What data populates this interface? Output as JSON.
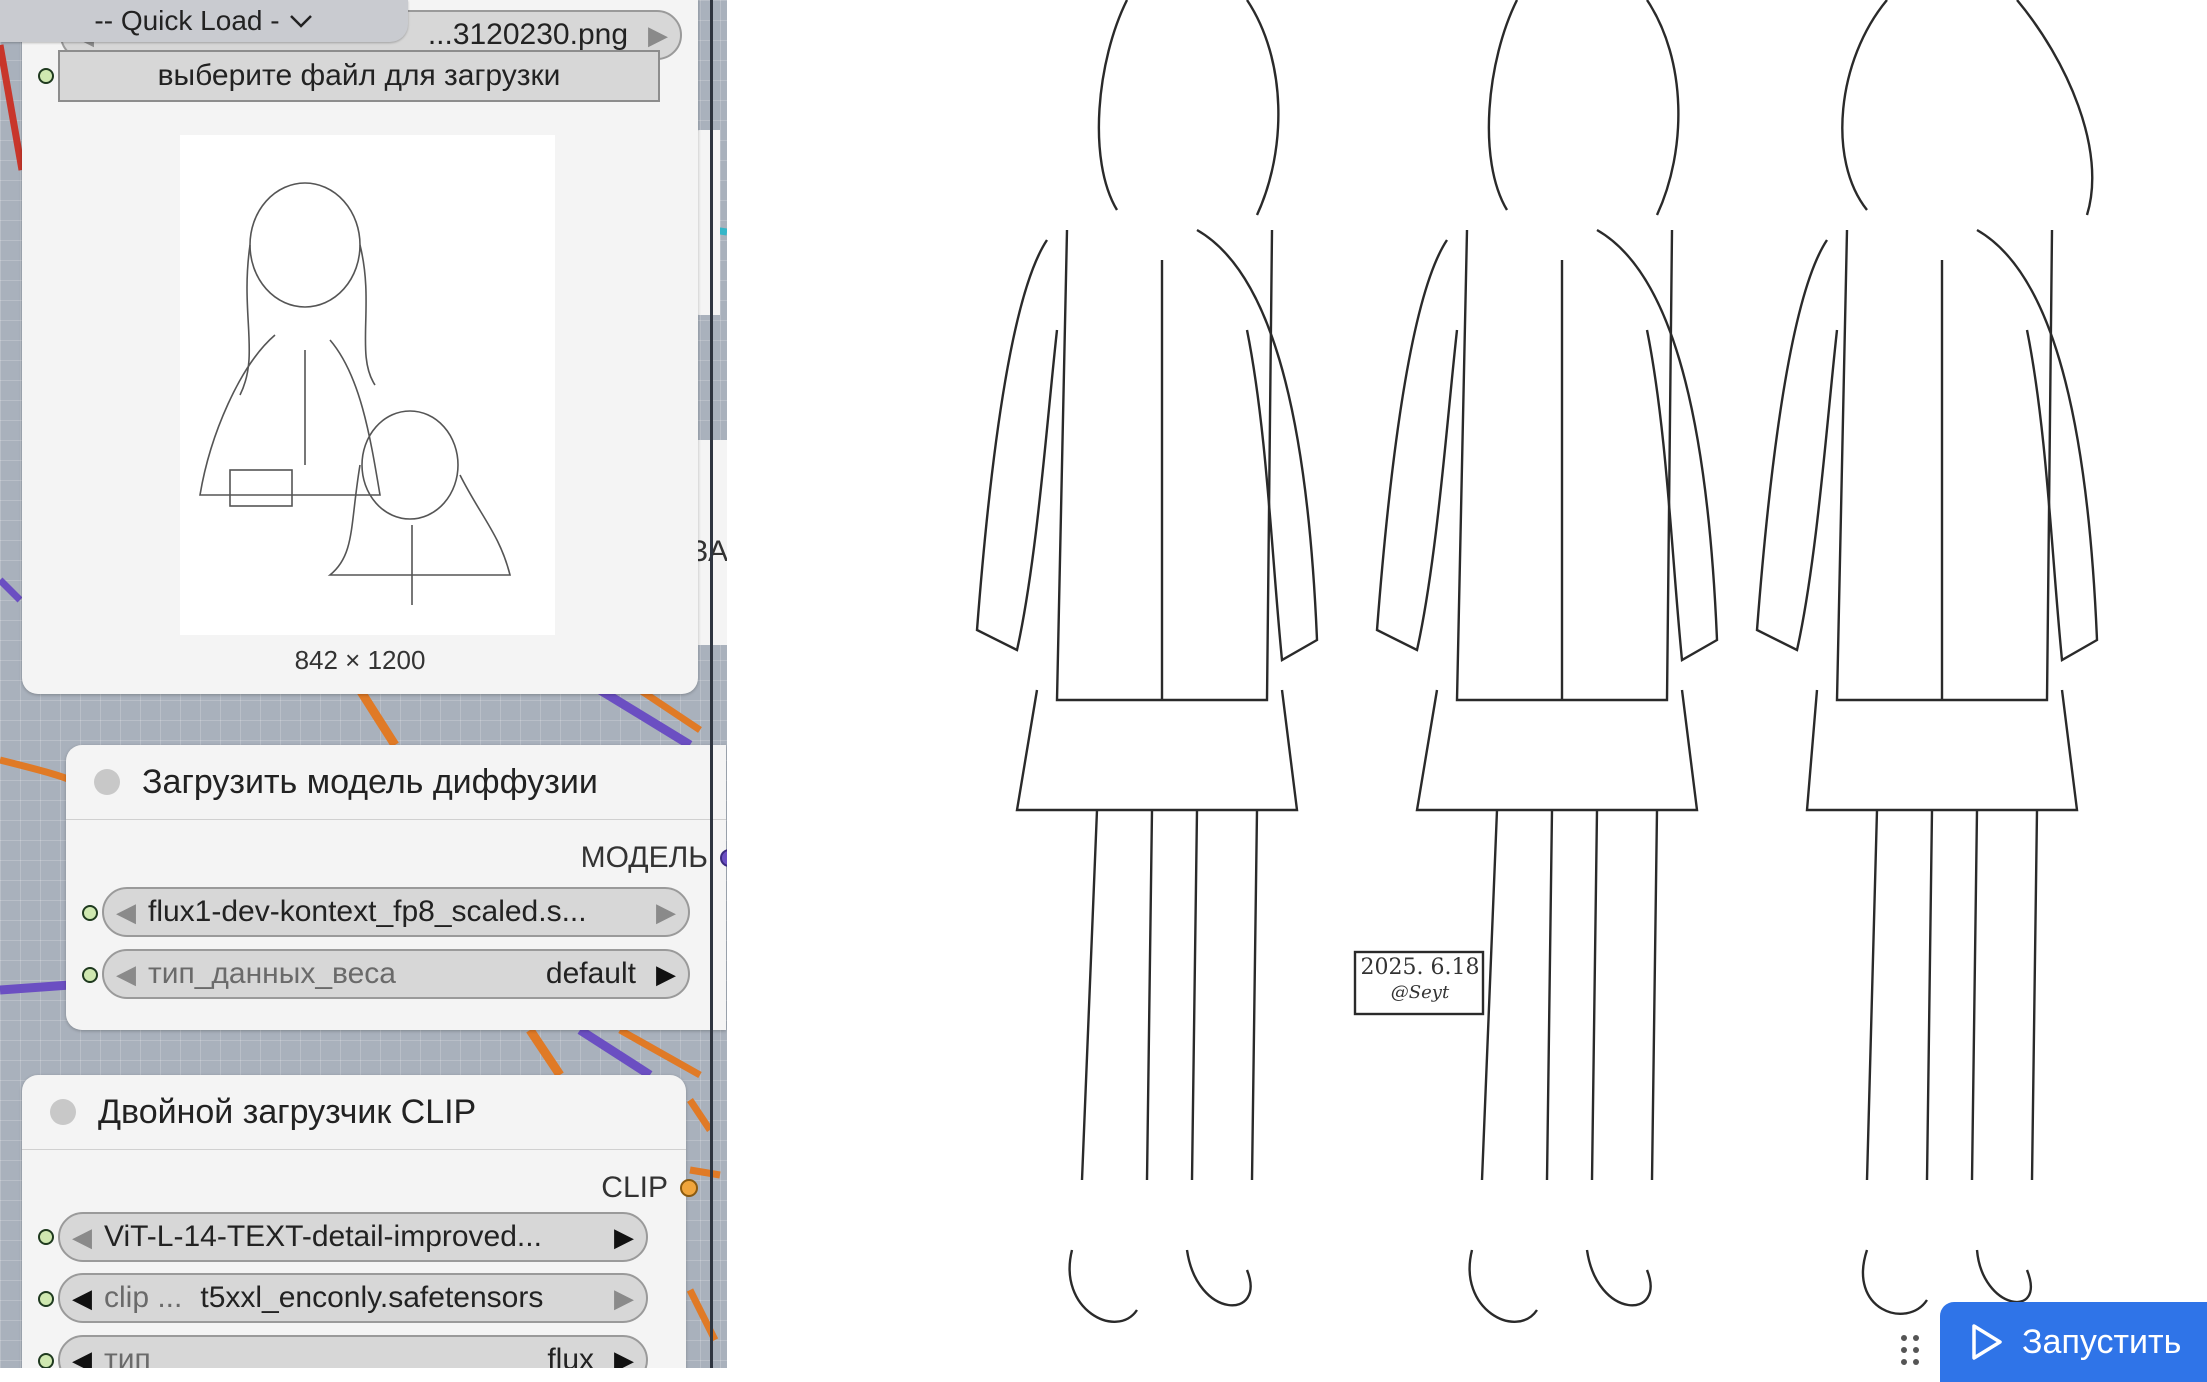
{
  "quick_load": {
    "label": "-- Quick Load -",
    "icon": "chevron-down-icon"
  },
  "load_image_node": {
    "image_widget_value": "...3120230.png",
    "upload_button": "выберите файл для загрузки",
    "dimensions": "842 × 1200"
  },
  "partial_label": "ЗА",
  "diffusion_node": {
    "title": "Загрузить модель диффузии",
    "output_label": "МОДЕЛЬ",
    "widgets": [
      {
        "label": "",
        "value": "flux1-dev-kontext_fp8_scaled.s..."
      },
      {
        "label": "тип_данных_веса",
        "value": "default"
      }
    ]
  },
  "clip_node": {
    "title": "Двойной загрузчик CLIP",
    "output_label": "CLIP",
    "widgets": [
      {
        "label": "",
        "value": "ViT-L-14-TEXT-detail-improved..."
      },
      {
        "label": "clip ...",
        "value": "t5xxl_enconly.safetensors"
      },
      {
        "label": "тип",
        "value": "flux"
      }
    ]
  },
  "preview": {
    "stamp_date": "2025. 6.18",
    "stamp_sign": "@Seyt"
  },
  "run_button": {
    "label": "Запустить",
    "icon": "play-icon"
  },
  "colors": {
    "accent": "#2f74e8",
    "wire_orange": "#e07a26",
    "wire_purple": "#6b4fc2",
    "wire_teal": "#35b6c8",
    "wire_red": "#c8362b"
  }
}
